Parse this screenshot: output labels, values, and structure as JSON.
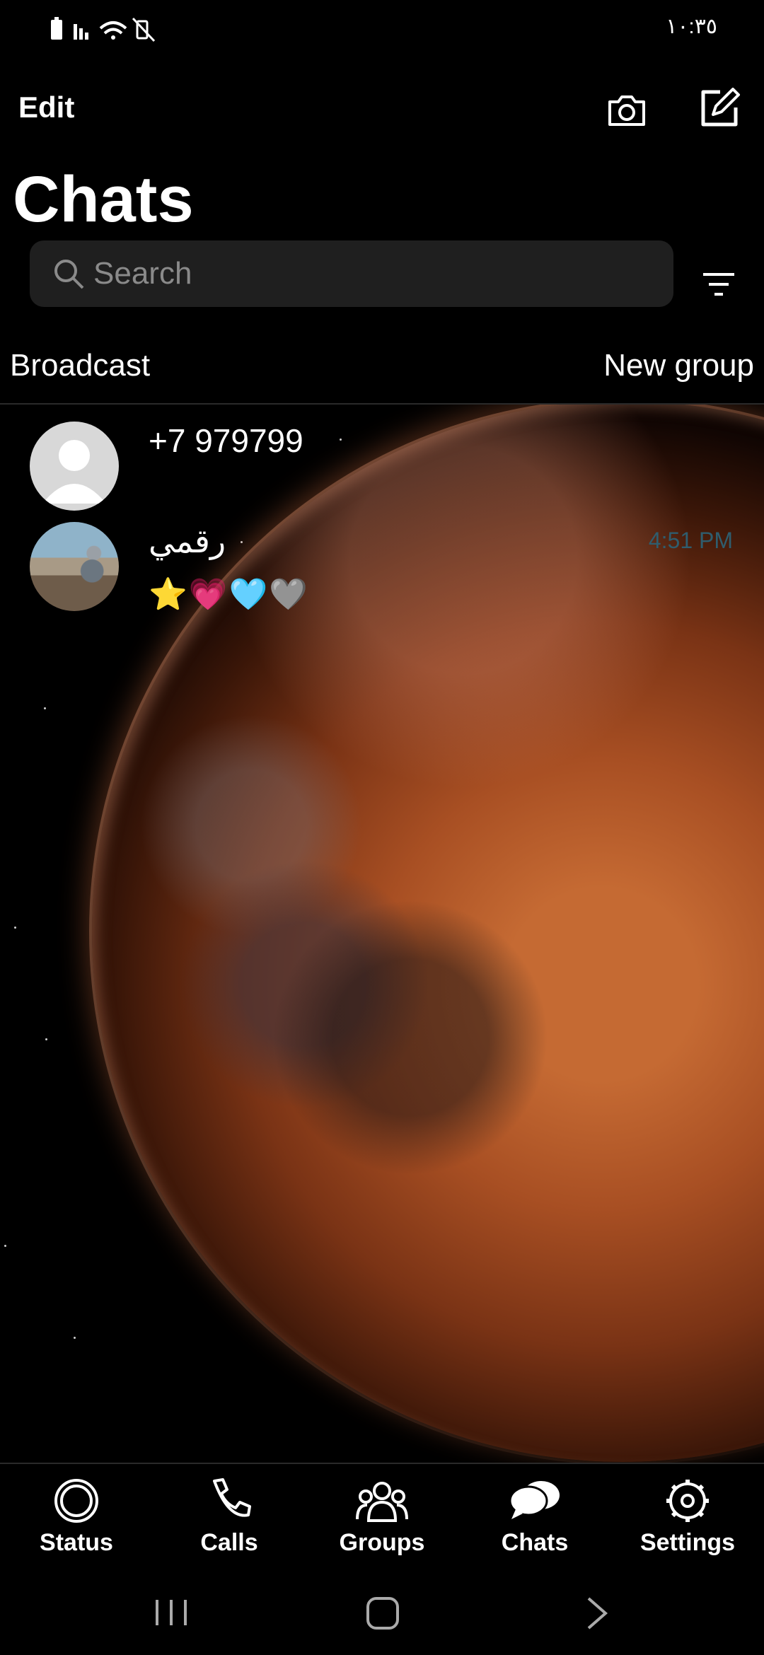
{
  "status_bar": {
    "time": "١٠:٣٥",
    "icons": [
      "battery-icon",
      "signal-icon",
      "wifi-icon",
      "vibrate-icon"
    ]
  },
  "header": {
    "edit_label": "Edit",
    "title": "Chats",
    "search_placeholder": "Search",
    "broadcast_label": "Broadcast",
    "new_group_label": "New group"
  },
  "chats": [
    {
      "name": "+7 979799",
      "time": "",
      "preview": ""
    },
    {
      "name": "رقمي",
      "time": "4:51 PM",
      "preview": "⭐💗🩵🩶"
    }
  ],
  "tabs": [
    {
      "label": "Status",
      "icon": "status-icon"
    },
    {
      "label": "Calls",
      "icon": "phone-icon"
    },
    {
      "label": "Groups",
      "icon": "groups-icon"
    },
    {
      "label": "Chats",
      "icon": "chat-bubbles-icon"
    },
    {
      "label": "Settings",
      "icon": "gear-icon"
    }
  ],
  "colors": {
    "background": "#000000",
    "search_bg": "#1f1f1f",
    "time_text": "#2f5d6e",
    "divider": "#2a2a2a"
  }
}
